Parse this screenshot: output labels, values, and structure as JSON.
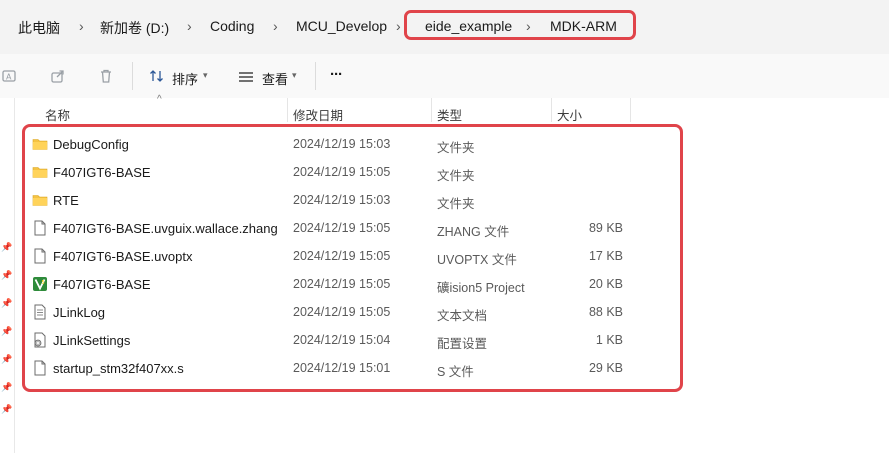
{
  "breadcrumb": [
    {
      "label": "此电脑"
    },
    {
      "label": "新加卷 (D:)"
    },
    {
      "label": "Coding"
    },
    {
      "label": "MCU_Develop"
    },
    {
      "label": "eide_example"
    },
    {
      "label": "MDK-ARM"
    }
  ],
  "toolbar": {
    "sort_label": "排序",
    "view_label": "查看",
    "more_label": "···"
  },
  "columns": {
    "name": "名称",
    "modified": "修改日期",
    "type": "类型",
    "size": "大小"
  },
  "files": [
    {
      "name": "DebugConfig",
      "modified": "2024/12/19 15:03",
      "type": "文件夹",
      "size": "",
      "icon": "folder-icon"
    },
    {
      "name": "F407IGT6-BASE",
      "modified": "2024/12/19 15:05",
      "type": "文件夹",
      "size": "",
      "icon": "folder-icon"
    },
    {
      "name": "RTE",
      "modified": "2024/12/19 15:03",
      "type": "文件夹",
      "size": "",
      "icon": "folder-icon"
    },
    {
      "name": "F407IGT6-BASE.uvguix.wallace.zhang",
      "modified": "2024/12/19 15:05",
      "type": "ZHANG 文件",
      "size": "89 KB",
      "icon": "file-icon"
    },
    {
      "name": "F407IGT6-BASE.uvoptx",
      "modified": "2024/12/19 15:05",
      "type": "UVOPTX 文件",
      "size": "17 KB",
      "icon": "file-icon"
    },
    {
      "name": "F407IGT6-BASE",
      "modified": "2024/12/19 15:05",
      "type": "礦ision5 Project",
      "size": "20 KB",
      "icon": "keil-project-icon"
    },
    {
      "name": "JLinkLog",
      "modified": "2024/12/19 15:05",
      "type": "文本文档",
      "size": "88 KB",
      "icon": "text-file-icon"
    },
    {
      "name": "JLinkSettings",
      "modified": "2024/12/19 15:04",
      "type": "配置设置",
      "size": "1 KB",
      "icon": "settings-file-icon"
    },
    {
      "name": "startup_stm32f407xx.s",
      "modified": "2024/12/19 15:01",
      "type": "S 文件",
      "size": "29 KB",
      "icon": "file-icon"
    }
  ],
  "colors": {
    "highlight": "#e0444a",
    "folder": "#f5c344",
    "keil_green": "#2e8b3a"
  }
}
